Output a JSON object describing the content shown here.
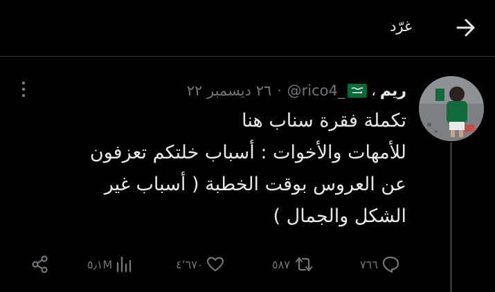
{
  "header": {
    "title": "غرّد",
    "back_icon": "arrow-right-icon"
  },
  "tweet": {
    "display_name": "ريم",
    "comma": "،",
    "flag_icon": "saudi-flag-icon",
    "handle": "@rico4_",
    "separator": "·",
    "date": "٢٦ ديسمبر ٢٢",
    "lines": [
      "تكملة فقرة سناب هنا",
      "للأمهات والأخوات : أسباب خلتكم تعزفون",
      "عن العروس بوقت الخطبة ( أسباب غير",
      "الشكل والجمال )"
    ]
  },
  "actions": {
    "reply": {
      "icon": "reply-icon",
      "count": "٧٦٦"
    },
    "retweet": {
      "icon": "retweet-icon",
      "count": "٥٨٧"
    },
    "like": {
      "icon": "heart-icon",
      "count": "٤٬٦٧٠"
    },
    "views": {
      "icon": "views-icon",
      "count": "٥٫١M"
    },
    "share": {
      "icon": "share-icon"
    }
  },
  "colors": {
    "background": "#000000",
    "text": "#e7e9ea",
    "muted": "#71767b",
    "divider": "#2f3336",
    "flag_green": "#006c35"
  }
}
